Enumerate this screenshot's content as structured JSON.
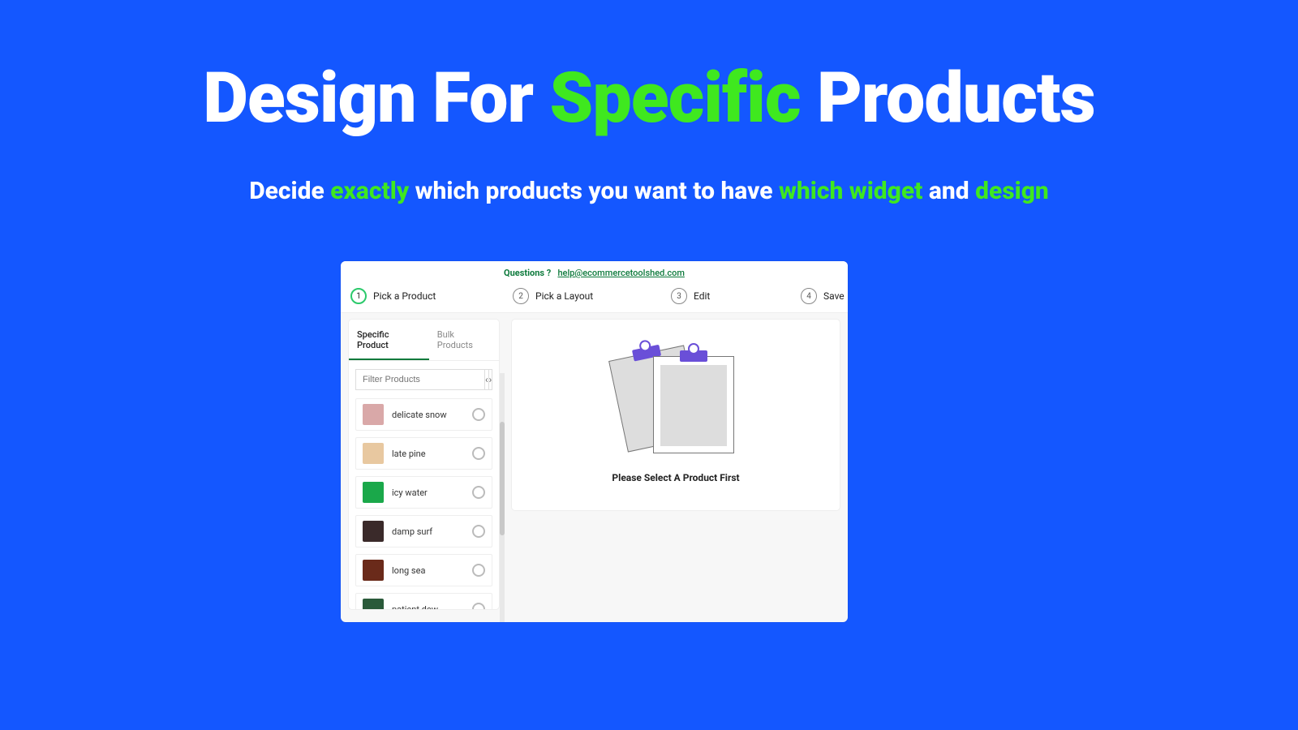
{
  "hero": {
    "title_pre": "Design For ",
    "title_accent": "Specific",
    "title_post": " Products",
    "sub_pre": "Decide ",
    "sub_accent1": "exactly",
    "sub_mid": " which products you want to have ",
    "sub_accent2": "which widget",
    "sub_mid2": " and ",
    "sub_accent3": "design"
  },
  "help": {
    "label": "Questions ?",
    "email": "help@ecommercetoolshed.com"
  },
  "steps": [
    {
      "num": "1",
      "label": "Pick a Product",
      "active": true
    },
    {
      "num": "2",
      "label": "Pick a Layout",
      "active": false
    },
    {
      "num": "3",
      "label": "Edit",
      "active": false
    },
    {
      "num": "4",
      "label": "Save",
      "active": false
    }
  ],
  "tabs": {
    "specific": "Specific Product",
    "bulk": "Bulk Products"
  },
  "filter": {
    "placeholder": "Filter Products"
  },
  "pager": {
    "prev": "‹",
    "next": "›"
  },
  "products": [
    {
      "name": "delicate snow",
      "color": "#d9a8a8"
    },
    {
      "name": "late pine",
      "color": "#e8c8a0"
    },
    {
      "name": "icy water",
      "color": "#1aa84a"
    },
    {
      "name": "damp surf",
      "color": "#3a2a2a"
    },
    {
      "name": "long sea",
      "color": "#6a2a1a"
    },
    {
      "name": "patient dew",
      "color": "#2a5a3a"
    }
  ],
  "placeholder": {
    "text": "Please Select A Product First"
  }
}
